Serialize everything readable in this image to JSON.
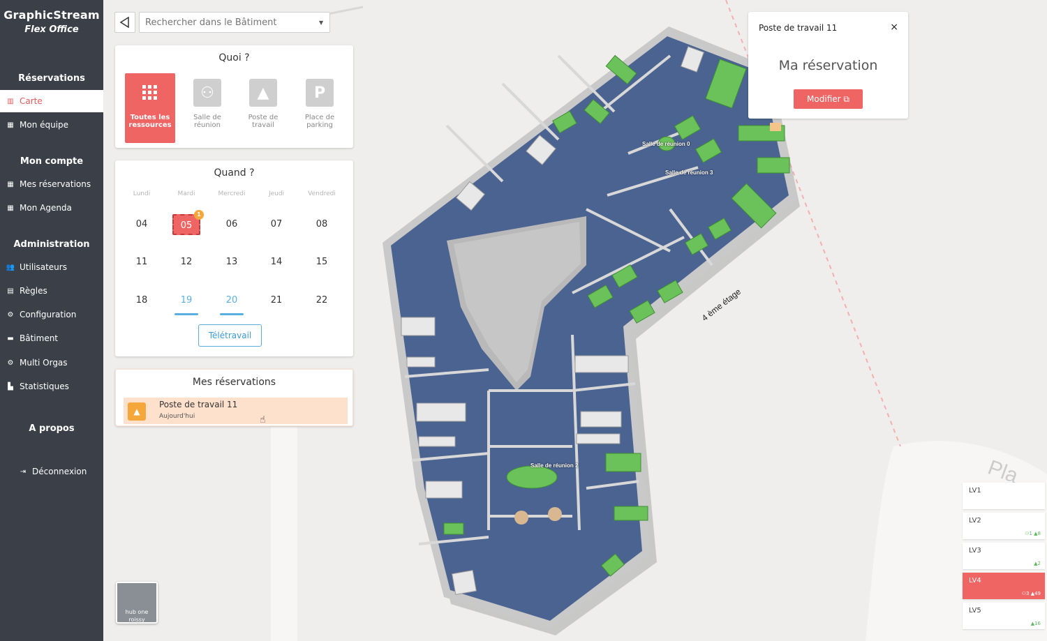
{
  "brand": {
    "name": "GraphicStream",
    "subtitle": "Flex Office"
  },
  "nav": {
    "sections": [
      {
        "label": "Réservations"
      },
      {
        "label": "Mon compte"
      },
      {
        "label": "Administration"
      },
      {
        "label": "A propos"
      }
    ],
    "items": [
      {
        "label": "Carte",
        "icon": "map-icon"
      },
      {
        "label": "Mon équipe",
        "icon": "calendar-icon"
      },
      {
        "label": "Mes réservations",
        "icon": "calendar-icon"
      },
      {
        "label": "Mon Agenda",
        "icon": "calendar-icon"
      },
      {
        "label": "Utilisateurs",
        "icon": "users-icon"
      },
      {
        "label": "Règles",
        "icon": "id-card-icon"
      },
      {
        "label": "Configuration",
        "icon": "gear-icon"
      },
      {
        "label": "Bâtiment",
        "icon": "building-icon"
      },
      {
        "label": "Multi Orgas",
        "icon": "gear-icon"
      },
      {
        "label": "Statistiques",
        "icon": "chart-icon"
      },
      {
        "label": "Déconnexion",
        "icon": "logout-icon"
      }
    ]
  },
  "search": {
    "placeholder": "Rechercher dans le Bâtiment"
  },
  "quoi": {
    "title": "Quoi ?",
    "resources": [
      {
        "label_line1": "Toutes les",
        "label_line2": "ressources",
        "icon": "grid-icon"
      },
      {
        "label_line1": "Salle de",
        "label_line2": "réunion",
        "icon": "meeting-room-icon"
      },
      {
        "label_line1": "Poste de",
        "label_line2": "travail",
        "icon": "desk-icon"
      },
      {
        "label_line1": "Place de",
        "label_line2": "parking",
        "icon": "parking-icon"
      }
    ]
  },
  "quand": {
    "title": "Quand ?",
    "weekdays": [
      "Lundi",
      "Mardi",
      "Mercredi",
      "Jeudi",
      "Vendredi"
    ],
    "weeks": [
      [
        "04",
        "05",
        "06",
        "07",
        "08"
      ],
      [
        "11",
        "12",
        "13",
        "14",
        "15"
      ],
      [
        "18",
        "19",
        "20",
        "21",
        "22"
      ]
    ],
    "selected_badge": "1",
    "teletravail_label": "Télétravail"
  },
  "mes_reservations": {
    "title": "Mes réservations",
    "item_title": "Poste de travail 11",
    "item_sub": "Aujourd'hui"
  },
  "popup": {
    "title": "Poste de travail 11",
    "close": "×",
    "heading": "Ma réservation",
    "modify_label": "Modifier ⧉"
  },
  "map": {
    "floor_label": "4 ème étage",
    "rooms": [
      "Salle de réunion 0",
      "Salle de réunion 3",
      "Salle de réunion 2"
    ],
    "street_text": "Pla"
  },
  "levels": [
    {
      "name": "LV1",
      "counts": ""
    },
    {
      "name": "LV2",
      "counts": "⚇1 ▲8"
    },
    {
      "name": "LV3",
      "counts": "▲2"
    },
    {
      "name": "LV4",
      "counts": "⚇3 ▲49"
    },
    {
      "name": "LV5",
      "counts": "▲16"
    }
  ],
  "thumb": {
    "line1": "hub one",
    "line2": "roissy"
  },
  "colors": {
    "sidebar": "#3b4048",
    "accent": "#ef6564",
    "floor": "#4a6391",
    "desk": "#6cc25a"
  }
}
